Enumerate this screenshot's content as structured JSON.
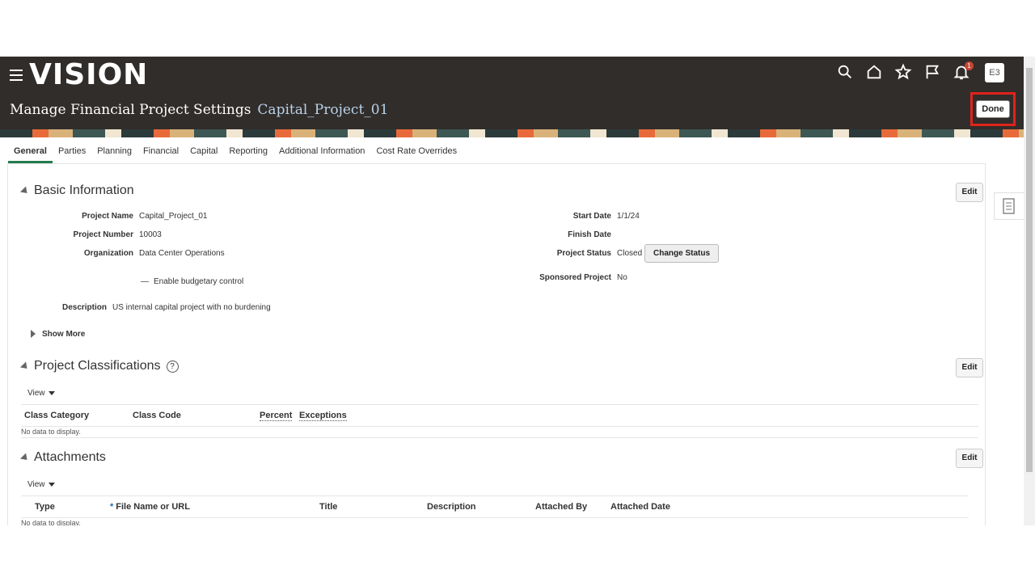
{
  "header": {
    "logo": "VISION",
    "page_title": "Manage Financial Project Settings",
    "project_name": "Capital_Project_01",
    "notification_count": "1",
    "user_initials": "E3",
    "done_label": "Done",
    "icons": [
      "search-icon",
      "home-icon",
      "star-icon",
      "flag-icon",
      "bell-icon"
    ]
  },
  "tabs": [
    "General",
    "Parties",
    "Planning",
    "Financial",
    "Capital",
    "Reporting",
    "Additional Information",
    "Cost Rate Overrides"
  ],
  "basic": {
    "title": "Basic Information",
    "edit": "Edit",
    "project_name_label": "Project Name",
    "project_name_value": "Capital_Project_01",
    "project_number_label": "Project Number",
    "project_number_value": "10003",
    "organization_label": "Organization",
    "organization_value": "Data Center Operations",
    "budgetary": "Enable budgetary control",
    "description_label": "Description",
    "description_value": "US internal capital project with no burdening",
    "show_more": "Show More",
    "start_date_label": "Start Date",
    "start_date_value": "1/1/24",
    "finish_date_label": "Finish Date",
    "project_status_label": "Project Status",
    "project_status_value": "Closed",
    "change_status": "Change Status",
    "sponsored_label": "Sponsored Project",
    "sponsored_value": "No"
  },
  "classifications": {
    "title": "Project Classifications",
    "edit": "Edit",
    "view": "View",
    "columns": [
      "Class Category",
      "Class Code",
      "Percent",
      "Exceptions"
    ],
    "nodata": "No data to display."
  },
  "attachments": {
    "title": "Attachments",
    "edit": "Edit",
    "view": "View",
    "columns": [
      "Type",
      "File Name or URL",
      "Title",
      "Description",
      "Attached By",
      "Attached Date"
    ],
    "required_mark": "*",
    "nodata": "No data to display."
  }
}
